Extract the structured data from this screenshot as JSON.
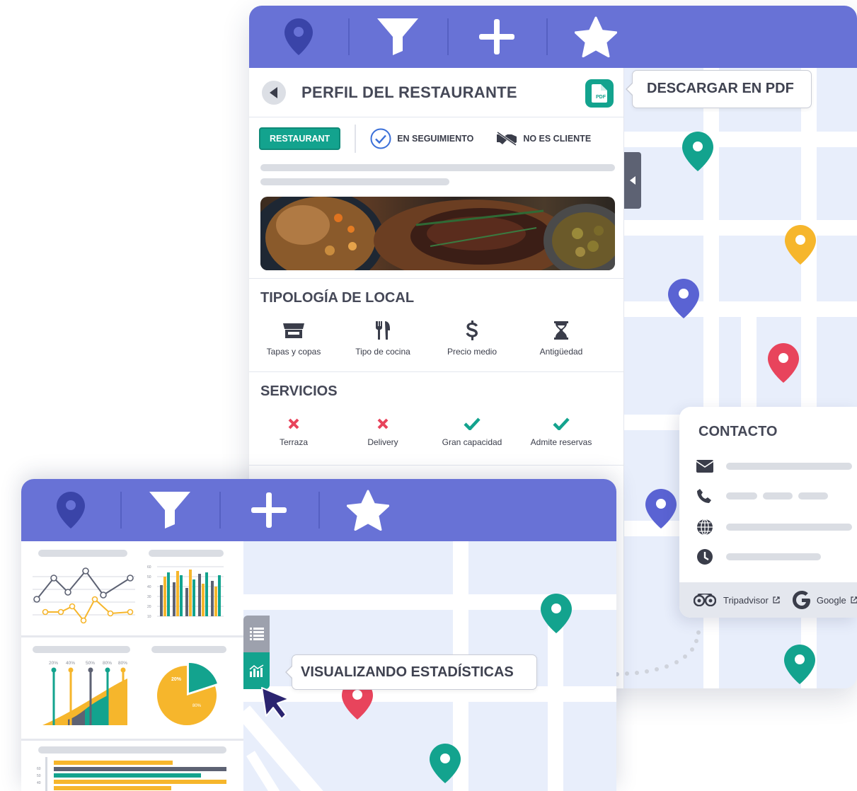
{
  "toolbar": {
    "items": [
      {
        "icon": "location-pin-icon"
      },
      {
        "icon": "filter-icon"
      },
      {
        "icon": "plus-icon"
      },
      {
        "icon": "star-icon"
      }
    ]
  },
  "profile": {
    "title": "PERFIL DEL RESTAURANTE",
    "pdf_badge": "PDF",
    "tags": {
      "type": "RESTAURANT",
      "following": "EN SEGUIMIENTO",
      "client": "NO ES CLIENTE"
    },
    "typology": {
      "title": "TIPOLOGÍA DE LOCAL",
      "items": [
        "Tapas y copas",
        "Tipo de cocina",
        "Precio medio",
        "Antigüedad"
      ]
    },
    "services": {
      "title": "SERVICIOS",
      "items": [
        {
          "label": "Terraza",
          "available": false
        },
        {
          "label": "Delivery",
          "available": false
        },
        {
          "label": "Gran capacidad",
          "available": true
        },
        {
          "label": "Admite reservas",
          "available": true
        }
      ]
    }
  },
  "callouts": {
    "pdf": "DESCARGAR EN PDF",
    "stats": "VISUALIZANDO ESTADÍSTICAS"
  },
  "contact": {
    "title": "CONTACTO",
    "links": [
      "Tripadvisor",
      "Google"
    ]
  },
  "stats": {
    "bar_percent_labels": [
      "20%",
      "40%",
      "50%",
      "80%",
      "80%"
    ],
    "pie": {
      "labels": [
        "20%",
        "80%"
      ],
      "values": [
        20,
        80
      ]
    },
    "axis_ticks": [
      "60",
      "50",
      "40",
      "30",
      "20",
      "10"
    ]
  },
  "colors": {
    "toolbar": "#6872d6",
    "teal": "#13a38e",
    "yellow": "#f6b62c",
    "red": "#e8445c",
    "indigo": "#5a63d3",
    "navy": "#3a44a8",
    "gray": "#5d6273"
  }
}
